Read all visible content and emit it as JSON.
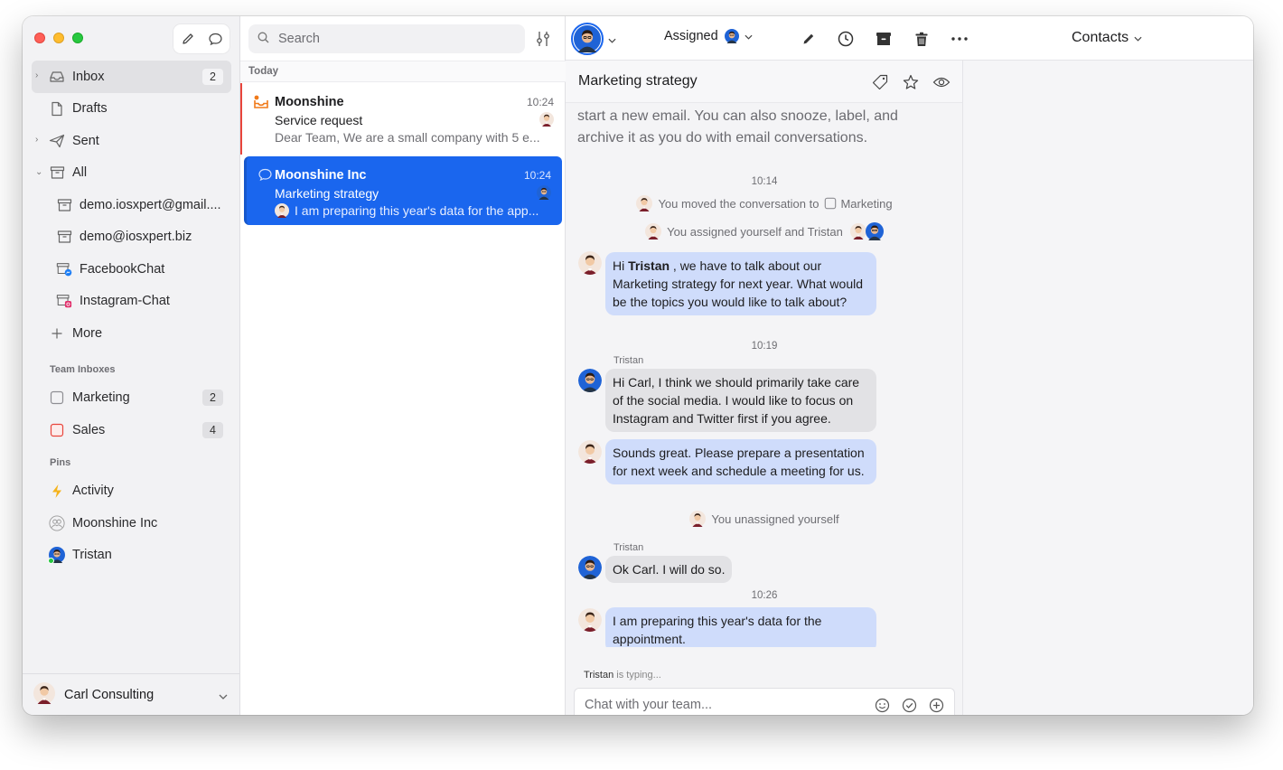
{
  "sidebar": {
    "nav": [
      {
        "label": "Inbox",
        "badge": "2"
      },
      {
        "label": "Drafts"
      },
      {
        "label": "Sent"
      },
      {
        "label": "All"
      },
      {
        "label": "demo.iosxpert@gmail...."
      },
      {
        "label": "demo@iosxpert.biz"
      },
      {
        "label": "FacebookChat"
      },
      {
        "label": "Instagram-Chat"
      },
      {
        "label": "More"
      }
    ],
    "team_title": "Team Inboxes",
    "teams": [
      {
        "label": "Marketing",
        "badge": "2",
        "color": "#8e8e93"
      },
      {
        "label": "Sales",
        "badge": "4",
        "color": "#e8453c"
      }
    ],
    "pins_title": "Pins",
    "pins": [
      {
        "label": "Activity"
      },
      {
        "label": "Moonshine Inc"
      },
      {
        "label": "Tristan"
      }
    ],
    "account": "Carl Consulting"
  },
  "list": {
    "search_placeholder": "Search",
    "group": "Today",
    "items": [
      {
        "name": "Moonshine",
        "time": "10:24",
        "subject": "Service request",
        "preview": "Dear Team, We are a small company with 5 e..."
      },
      {
        "name": "Moonshine Inc",
        "time": "10:24",
        "subject": "Marketing strategy",
        "preview": "I am preparing this year's data for the app..."
      }
    ]
  },
  "toolbar": {
    "assigned": "Assigned",
    "contacts": "Contacts"
  },
  "conversation": {
    "title": "Marketing strategy",
    "email_tail": "start a new email. You can also snooze, label, and archive it as you do with email conversations.",
    "events": [
      {
        "time": "10:14"
      },
      {
        "text": "You moved the conversation to",
        "target": "Marketing"
      },
      {
        "text": "You assigned yourself and Tristan"
      }
    ],
    "msg1": {
      "pre": "Hi ",
      "bold": "Tristan",
      "post": " , we have to talk about our Marketing strategy for next year. What would be the topics you would like to talk about?"
    },
    "time2": "10:19",
    "sender2": "Tristan",
    "msg2": "Hi Carl, I think we should primarily take care of the social media. I would like to focus on Instagram and Twitter first if you agree.",
    "msg3": "Sounds great. Please prepare a presentation for next week and schedule a meeting for us.",
    "event_unassign": "You unassigned yourself",
    "sender4": "Tristan",
    "msg4": "Ok Carl. I will do so.",
    "time3": "10:26",
    "msg5": "I am preparing this year's data for the appointment.",
    "typing_name": "Tristan",
    "typing_text": "is typing...",
    "chat_placeholder": "Chat with your team..."
  },
  "colors": {
    "accent": "#1a66ee",
    "bubble_me": "#cfdcfb",
    "bubble_them": "#e2e2e5",
    "unread_bar": "#e8453c"
  }
}
